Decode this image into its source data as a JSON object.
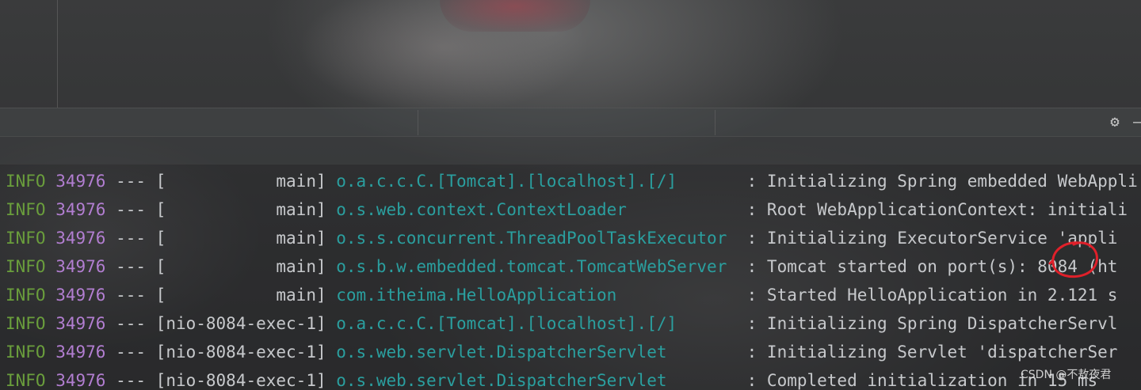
{
  "toolbar": {
    "settings_icon": "gear-icon",
    "hide_icon": "minus-icon"
  },
  "console": {
    "lines": [
      {
        "level": "INFO",
        "pid": "34976",
        "sep": " --- ",
        "thread": "[           main]",
        "logger": "o.a.c.c.C.[Tomcat].[localhost].[/]      ",
        "message": " : Initializing Spring embedded WebAppli"
      },
      {
        "level": "INFO",
        "pid": "34976",
        "sep": " --- ",
        "thread": "[           main]",
        "logger": "o.s.web.context.ContextLoader           ",
        "message": " : Root WebApplicationContext: initiali"
      },
      {
        "level": "INFO",
        "pid": "34976",
        "sep": " --- ",
        "thread": "[           main]",
        "logger": "o.s.s.concurrent.ThreadPoolTaskExecutor ",
        "message": " : Initializing ExecutorService 'appli"
      },
      {
        "level": "INFO",
        "pid": "34976",
        "sep": " --- ",
        "thread": "[           main]",
        "logger": "o.s.b.w.embedded.tomcat.TomcatWebServer ",
        "message": " : Tomcat started on port(s): 8084 (ht"
      },
      {
        "level": "INFO",
        "pid": "34976",
        "sep": " --- ",
        "thread": "[           main]",
        "logger": "com.itheima.HelloApplication            ",
        "message": " : Started HelloApplication in 2.121 s"
      },
      {
        "level": "INFO",
        "pid": "34976",
        "sep": " --- ",
        "thread": "[nio-8084-exec-1]",
        "logger": "o.a.c.c.C.[Tomcat].[localhost].[/]      ",
        "message": " : Initializing Spring DispatcherServl"
      },
      {
        "level": "INFO",
        "pid": "34976",
        "sep": " --- ",
        "thread": "[nio-8084-exec-1]",
        "logger": "o.s.web.servlet.DispatcherServlet       ",
        "message": " : Initializing Servlet 'dispatcherSer"
      },
      {
        "level": "INFO",
        "pid": "34976",
        "sep": " --- ",
        "thread": "[nio-8084-exec-1]",
        "logger": "o.s.web.servlet.DispatcherServlet       ",
        "message": " : Completed initialization in 15 ms"
      }
    ]
  },
  "watermark": {
    "text": "CSDN @不敖夜君"
  },
  "colors": {
    "level": "#6a9e3c",
    "pid": "#b27ed1",
    "logger": "#2a9f9f",
    "text": "#c7c9cc",
    "annotation": "#e0202a"
  }
}
